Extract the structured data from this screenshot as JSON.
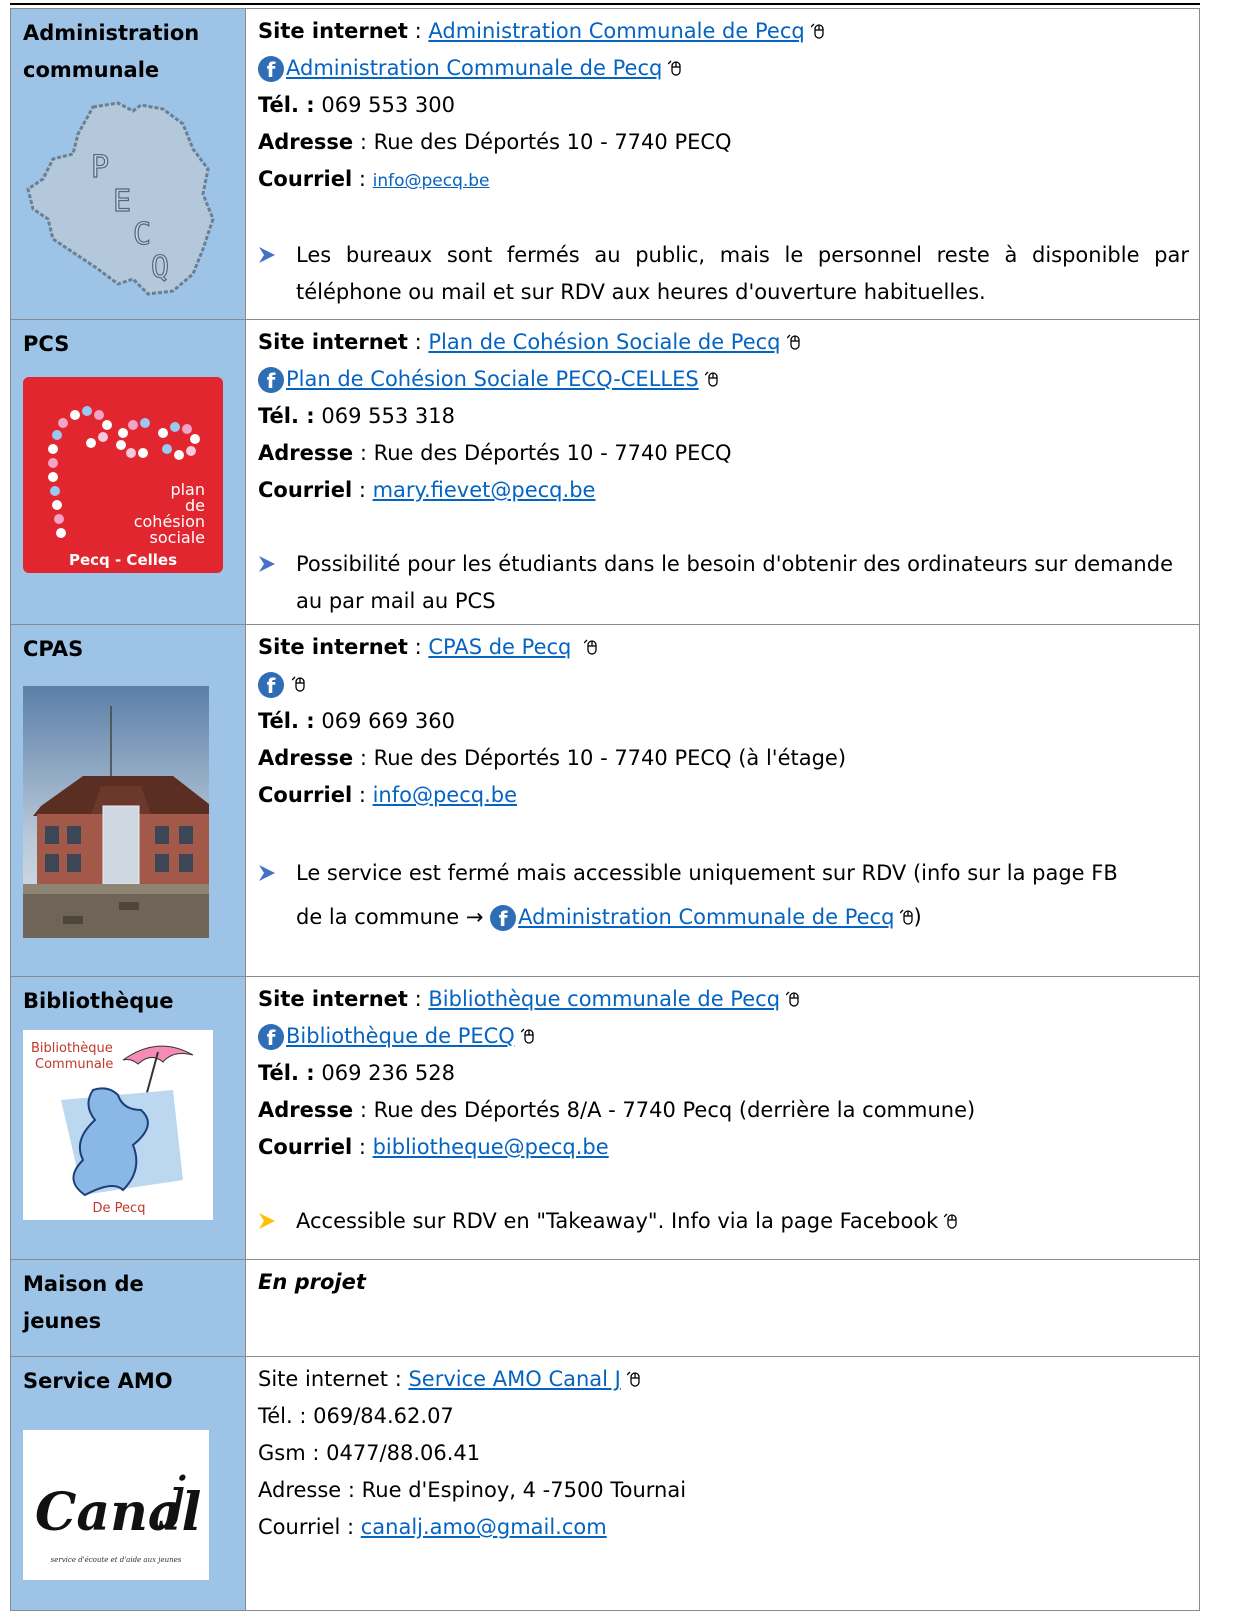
{
  "rows": [
    {
      "name": "Administration communale",
      "site_label": "Site internet",
      "site_link": "Administration Communale de Pecq",
      "fb_link": "Administration Communale de Pecq",
      "tel_label": "Tél. :",
      "tel": "069 553 300",
      "addr_label": "Adresse",
      "addr": "Rue des Déportés 10 - 7740 PECQ",
      "mail_label": "Courriel",
      "mail": "info@pecq.be",
      "note": "Les bureaux sont fermés au public, mais le personnel reste à disponible par téléphone ou mail et sur RDV aux heures d'ouverture habituelles.",
      "logo_letters": [
        "P",
        "E",
        "C",
        "Q"
      ]
    },
    {
      "name": "PCS",
      "site_label": "Site internet",
      "site_link": "Plan de Cohésion Sociale de Pecq",
      "fb_link": "Plan de Cohésion Sociale PECQ-CELLES",
      "tel_label": "Tél. :",
      "tel": "069 553 318",
      "addr_label": "Adresse",
      "addr": "Rue des Déportés 10 - 7740 PECQ",
      "mail_label": "Courriel",
      "mail": "mary.fievet@pecq.be",
      "note": "Possibilité pour les étudiants dans le besoin d'obtenir des ordinateurs sur demande au par mail au PCS",
      "logo_lines": [
        "plan",
        "de",
        "cohésion",
        "sociale"
      ],
      "logo_footer": "Pecq - Celles"
    },
    {
      "name": "CPAS",
      "site_label": "Site internet",
      "site_link": "CPAS de Pecq",
      "tel_label": "Tél. :",
      "tel": "069 669 360",
      "addr_label": "Adresse",
      "addr": "Rue des Déportés 10 - 7740 PECQ (à l'étage)",
      "mail_label": "Courriel",
      "mail": "info@pecq.be",
      "note_a": "Le service est fermé mais accessible uniquement sur RDV (info sur la page FB",
      "note_b": "de la commune →",
      "note_link": "Administration Communale de Pecq",
      "note_end": ")"
    },
    {
      "name": "Bibliothèque",
      "site_label": "Site internet",
      "site_link": "Bibliothèque communale de Pecq",
      "fb_link": "Bibliothèque de PECQ",
      "tel_label": "Tél. :",
      "tel": "069 236 528",
      "addr_label": "Adresse",
      "addr": "Rue des Déportés 8/A - 7740 Pecq (derrière la commune)",
      "mail_label": "Courriel",
      "mail": "bibliotheque@pecq.be",
      "note": "Accessible sur RDV en \"Takeaway\". Info via la page Facebook",
      "logo_title_1": "Bibliothèque",
      "logo_title_2": "Communale",
      "logo_footer": "De Pecq"
    },
    {
      "name": "Maison de jeunes",
      "status": "En projet"
    },
    {
      "name": "Service AMO",
      "site_label": "Site internet :",
      "site_link": "Service AMO Canal J",
      "tel_line": "Tél. :  069/84.62.07",
      "gsm_line": "Gsm : 0477/88.06.41",
      "addr_line": "Adresse : Rue d'Espinoy, 4 -7500 Tournai",
      "mail_label": "Courriel :",
      "mail": "canalj.amo@gmail.com",
      "logo_text": "Canal",
      "logo_j": "j",
      "logo_sub": "service d'écoute et d'aide aux jeunes"
    }
  ],
  "colors": {
    "left_cell": "#9dc3e6",
    "link": "#0563c1",
    "facebook": "#2f6db5",
    "bullet": "#4472c4",
    "bullet_alt": "#ffc000"
  },
  "icons": [
    "facebook-icon",
    "mouse-icon",
    "arrow-bullet-icon"
  ]
}
